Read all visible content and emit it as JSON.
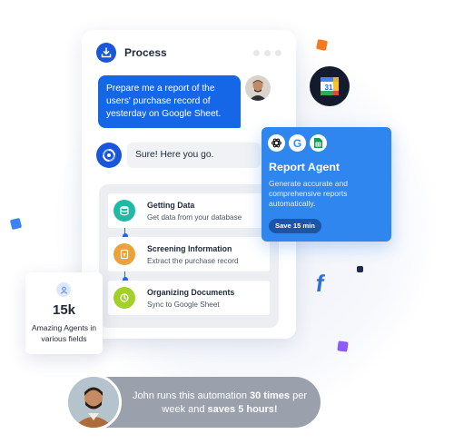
{
  "process_card": {
    "title": "Process",
    "user_message": "Prepare me a report of the users' purchase record of yesterday on Google Sheet.",
    "agent_reply": "Sure! Here you go.",
    "steps": [
      {
        "title": "Getting Data",
        "subtitle": "Get data from your database",
        "icon": "database-icon",
        "color": "#22b8a6"
      },
      {
        "title": "Screening Information",
        "subtitle": "Extract the purchase record",
        "icon": "document-filter-icon",
        "color": "#e8a33d"
      },
      {
        "title": "Organizing Documents",
        "subtitle": "Sync to Google Sheet",
        "icon": "sync-icon",
        "color": "#a3d12a"
      }
    ]
  },
  "report_agent": {
    "title": "Report Agent",
    "description": "Generate accurate and comprehensive reports automatically.",
    "badge": "Save 15 min",
    "icons": [
      "chatgpt-icon",
      "google-icon",
      "google-sheets-icon"
    ]
  },
  "stat_card": {
    "value": "15k",
    "description": "Amazing Agents in various fields",
    "icon": "user-icon"
  },
  "testimonial": {
    "prefix": "John runs this automation ",
    "emph1": "30 times",
    "middle": " per week and ",
    "emph2": "saves 5 hours!"
  },
  "floating_icons": [
    "google-calendar-icon",
    "facebook-icon"
  ],
  "colors": {
    "primary_blue": "#1667e8",
    "report_card": "#2f86ee",
    "pill": "#9aa1ad"
  }
}
